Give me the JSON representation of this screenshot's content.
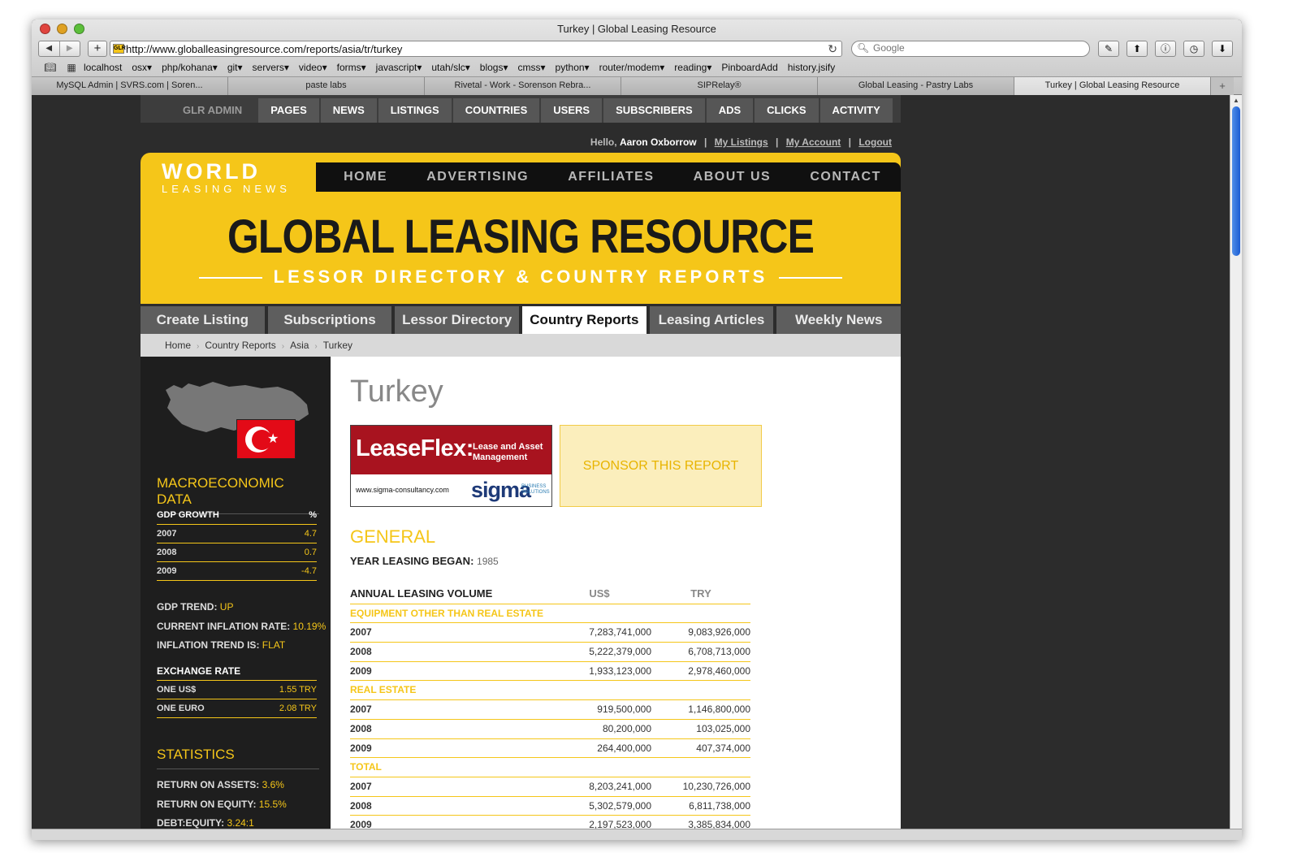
{
  "window": {
    "title": "Turkey | Global Leasing Resource"
  },
  "toolbar": {
    "url": "http://www.globalleasingresource.com/reports/asia/tr/turkey",
    "favicon_text": "GLR",
    "search_placeholder": "Google"
  },
  "bookmarks": [
    "localhost",
    "osx▾",
    "php/kohana▾",
    "git▾",
    "servers▾",
    "video▾",
    "forms▾",
    "javascript▾",
    "utah/slc▾",
    "blogs▾",
    "cmss▾",
    "python▾",
    "router/modem▾",
    "reading▾",
    "PinboardAdd",
    "history.jsify"
  ],
  "tabs": [
    "MySQL Admin | SVRS.com | Soren...",
    "paste labs",
    "Rivetal - Work - Sorenson Rebra...",
    "SIPRelay®",
    "Global Leasing - Pastry Labs",
    "Turkey | Global Leasing Resource"
  ],
  "admin_nav": [
    "GLR ADMIN",
    "PAGES",
    "NEWS",
    "LISTINGS",
    "COUNTRIES",
    "USERS",
    "SUBSCRIBERS",
    "ADS",
    "CLICKS",
    "ACTIVITY"
  ],
  "user": {
    "hello": "Hello,",
    "name": "Aaron Oxborrow",
    "my_listings": "My Listings",
    "my_account": "My Account",
    "logout": "Logout",
    "sep": "|"
  },
  "logo": {
    "line1": "WORLD",
    "line2": "LEASING NEWS"
  },
  "header_nav": [
    "HOME",
    "ADVERTISING",
    "AFFILIATES",
    "ABOUT US",
    "CONTACT"
  ],
  "banner": {
    "title": "GLOBAL LEASING RESOURCE",
    "subtitle": "LESSOR DIRECTORY & COUNTRY REPORTS"
  },
  "main_nav": [
    "Create Listing",
    "Subscriptions",
    "Lessor Directory",
    "Country Reports",
    "Leasing Articles",
    "Weekly News"
  ],
  "breadcrumb": [
    "Home",
    "Country Reports",
    "Asia",
    "Turkey"
  ],
  "sidebar": {
    "macro_title": "MACROECONOMIC DATA",
    "gdp_header": {
      "label": "GDP GROWTH",
      "unit": "%"
    },
    "gdp_rows": [
      {
        "year": "2007",
        "value": "4.7"
      },
      {
        "year": "2008",
        "value": "0.7"
      },
      {
        "year": "2009",
        "value": "-4.7"
      }
    ],
    "gdp_trend_label": "GDP TREND:",
    "gdp_trend": "UP",
    "inflation_label": "CURRENT INFLATION RATE:",
    "inflation": "10.19%",
    "inflation_trend_label": "INFLATION TREND IS:",
    "inflation_trend": "FLAT",
    "exchange_title": "EXCHANGE RATE",
    "exchange_rows": [
      {
        "label": "ONE US$",
        "value": "1.55 TRY"
      },
      {
        "label": "ONE EURO",
        "value": "2.08 TRY"
      }
    ],
    "stats_title": "STATISTICS",
    "roa_label": "RETURN ON ASSETS:",
    "roa": "3.6%",
    "roe_label": "RETURN ON EQUITY:",
    "roe": "15.5%",
    "de_label": "DEBT:EQUITY:",
    "de": "3.24:1"
  },
  "content": {
    "country": "Turkey",
    "ad": {
      "brand": "LeaseFlex:",
      "tagline_1": "Lease and Asset",
      "tagline_2": "Management",
      "url": "www.sigma-consultancy.com",
      "sigma": "sigma",
      "sigma_sub": "BUSINESS SOLUTIONS"
    },
    "sponsor": "SPONSOR THIS REPORT",
    "general_title": "GENERAL",
    "year_label": "YEAR LEASING BEGAN:",
    "year_value": "1985",
    "volume_header": {
      "label": "ANNUAL LEASING VOLUME",
      "col1": "US$",
      "col2": "TRY"
    },
    "sections": [
      {
        "name": "EQUIPMENT OTHER THAN REAL ESTATE",
        "rows": [
          {
            "year": "2007",
            "usd": "7,283,741,000",
            "try": "9,083,926,000"
          },
          {
            "year": "2008",
            "usd": "5,222,379,000",
            "try": "6,708,713,000"
          },
          {
            "year": "2009",
            "usd": "1,933,123,000",
            "try": "2,978,460,000"
          }
        ]
      },
      {
        "name": "REAL ESTATE",
        "rows": [
          {
            "year": "2007",
            "usd": "919,500,000",
            "try": "1,146,800,000"
          },
          {
            "year": "2008",
            "usd": "80,200,000",
            "try": "103,025,000"
          },
          {
            "year": "2009",
            "usd": "264,400,000",
            "try": "407,374,000"
          }
        ]
      },
      {
        "name": "TOTAL",
        "rows": [
          {
            "year": "2007",
            "usd": "8,203,241,000",
            "try": "10,230,726,000"
          },
          {
            "year": "2008",
            "usd": "5,302,579,000",
            "try": "6,811,738,000"
          },
          {
            "year": "2009",
            "usd": "2,197,523,000",
            "try": "3,385,834,000"
          }
        ]
      }
    ]
  }
}
